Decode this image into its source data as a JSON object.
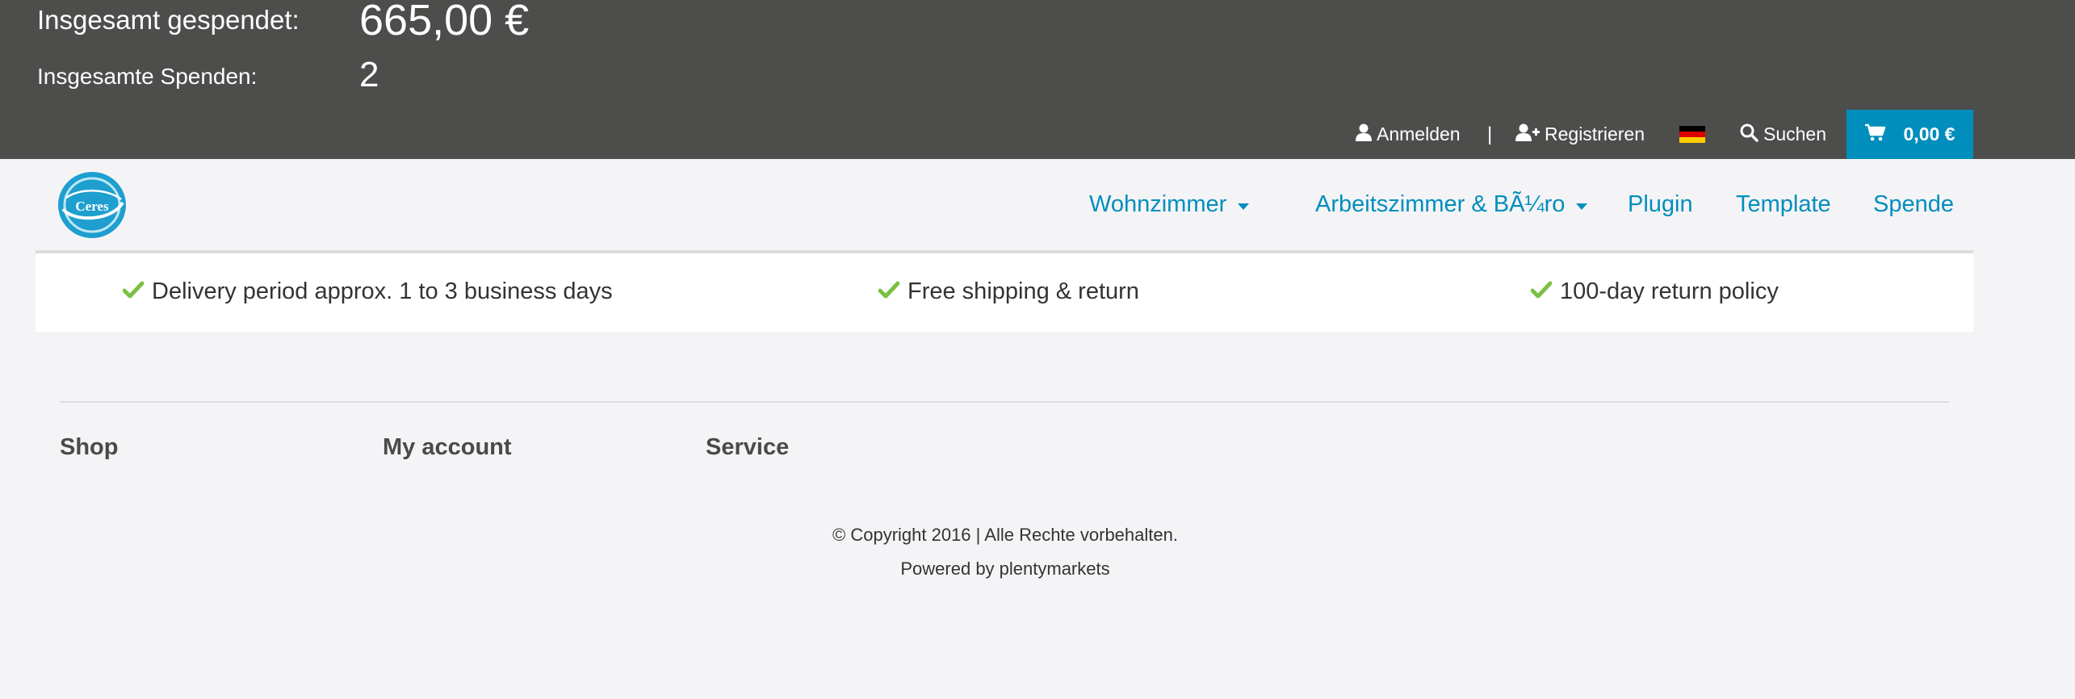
{
  "stats": {
    "donated_label": "Insgesamt gespendet:",
    "donated_value": "665,00 €",
    "count_label": "Insgesamte Spenden:",
    "count_value": "2"
  },
  "utility_nav": {
    "login_label": "Anmelden",
    "separator": "|",
    "register_label": "Registrieren",
    "language_flag": "de",
    "search_label": "Suchen",
    "cart_total": "0,00 €"
  },
  "icons": {
    "login": "user-icon",
    "register": "user-plus-icon",
    "search": "search-icon",
    "cart": "shopping-cart-icon",
    "check": "check-icon",
    "logo": "ceres-logo"
  },
  "brand": {
    "logo_text": "Ceres"
  },
  "main_nav": {
    "items": [
      {
        "label": "Wohnzimmer",
        "has_dropdown": true
      },
      {
        "label": "Arbeitszimmer & BÃ¼ro",
        "has_dropdown": true
      },
      {
        "label": "Plugin",
        "has_dropdown": false
      },
      {
        "label": "Template",
        "has_dropdown": false
      },
      {
        "label": "Spende",
        "has_dropdown": false
      }
    ]
  },
  "benefits": [
    "Delivery period approx. 1 to 3 business days",
    "Free shipping & return",
    "100-day return policy"
  ],
  "footer": {
    "columns": [
      "Shop",
      "My account",
      "Service"
    ],
    "copyright": "© Copyright 2016 | Alle Rechte vorbehalten.",
    "powered_by": "Powered by plentymarkets"
  },
  "colors": {
    "header_bg": "#4d4e4c",
    "accent": "#008ebd",
    "check": "#7ac143",
    "page_bg": "#f4f4f7"
  }
}
